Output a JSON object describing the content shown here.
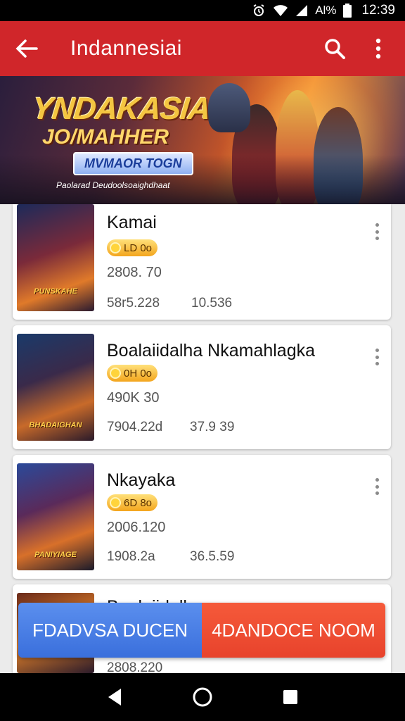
{
  "status_bar": {
    "battery_text": "Al%",
    "time": "12:39"
  },
  "app_bar": {
    "title": "Indannesiai"
  },
  "banner": {
    "title_line1": "YNDAKASIA",
    "title_line2": "JO/MAHHER",
    "subtitle": "MVMAOR TOGN",
    "caption": "Paolarad Deudoolsoaighdhaat"
  },
  "items": [
    {
      "name": "Kamai",
      "badge": "LD 0o",
      "stat1": "2808. 70",
      "stat2": "58r5.228",
      "stat3": "10.536",
      "thumb_label": "PUNSKAHE"
    },
    {
      "name": "Boalaiidalha Nkamahlagka",
      "badge": "0H 0o",
      "stat1": "490K 30",
      "stat2": "7904.22d",
      "stat3": "37.9 39",
      "thumb_label": "BHADAIGHAN"
    },
    {
      "name": "Nkayaka",
      "badge": "6D 8o",
      "stat1": "2006.120",
      "stat2": "1908.2a",
      "stat3": "36.5.59",
      "thumb_label": "PANIYIAGE"
    },
    {
      "name": "Boalaiidalha",
      "badge": "",
      "stat1": "",
      "stat2": "2808.220",
      "stat3": "",
      "thumb_label": ""
    }
  ],
  "actions": {
    "left_label": "FDADVSA DUCEN",
    "right_label": "4DANDOCE NOOM"
  },
  "colors": {
    "app_bar": "#d0262a",
    "left_button": "#4a7fe6",
    "right_button": "#ee4b30"
  }
}
